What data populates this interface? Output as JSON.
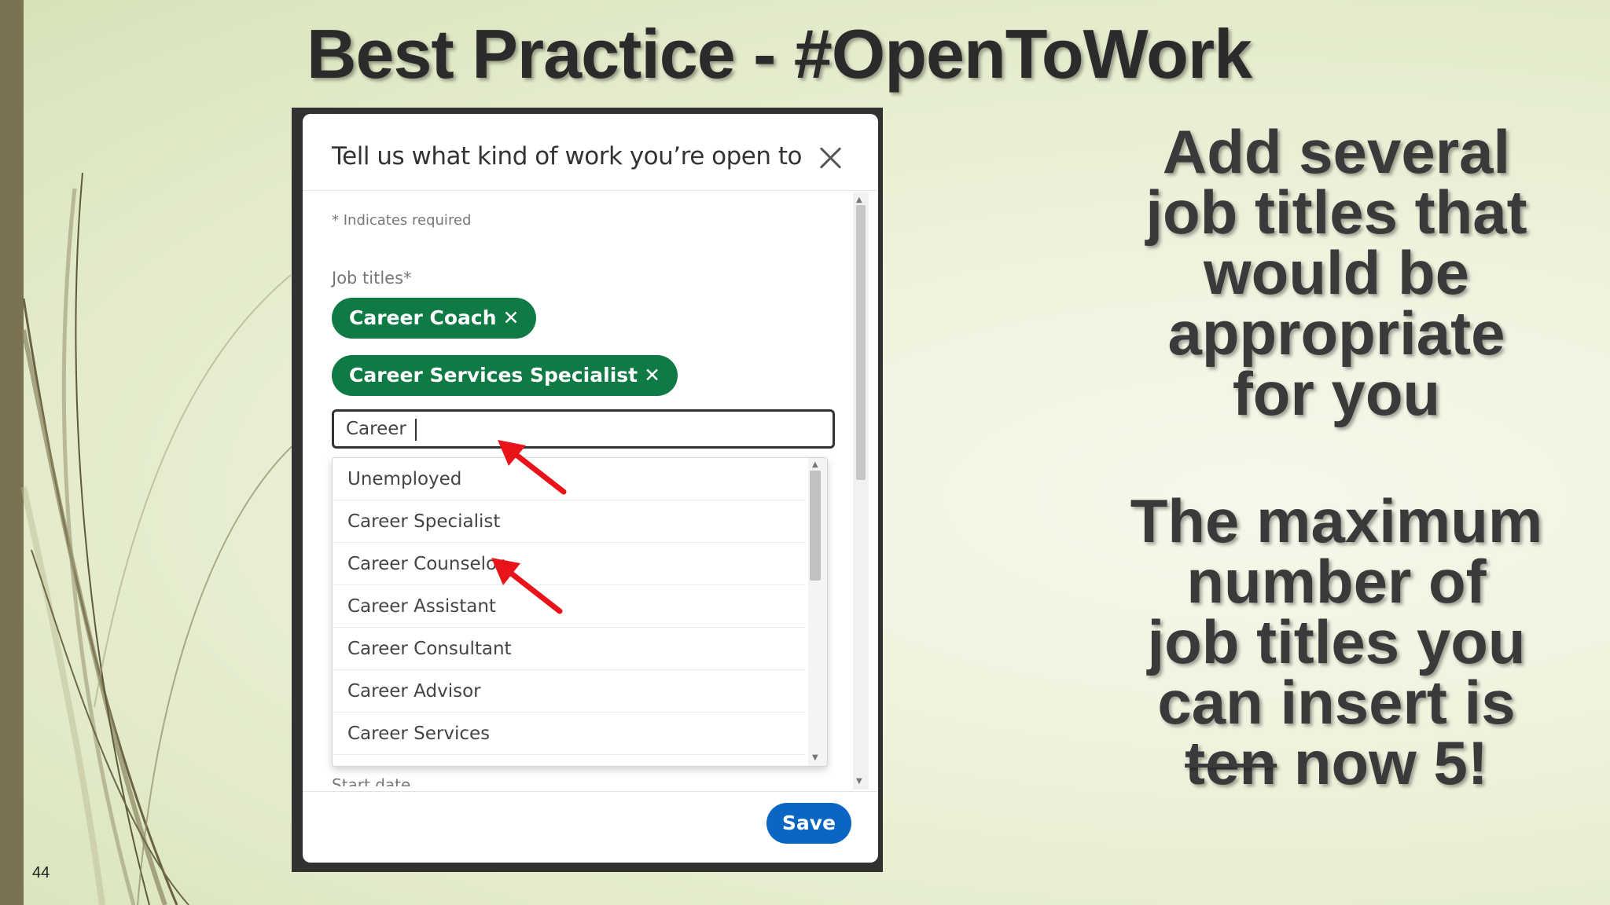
{
  "slide": {
    "title": "Best Practice - #OpenToWork",
    "page_number": "44"
  },
  "modal": {
    "title": "Tell us what kind of work you’re open to",
    "required_note": "* Indicates required",
    "job_titles_label": "Job titles*",
    "chips": [
      {
        "label": "Career Coach",
        "remove": "✕"
      },
      {
        "label": "Career Services Specialist",
        "remove": "✕"
      }
    ],
    "input_value": "Career ",
    "suggestions": [
      "Unemployed",
      "Career Specialist",
      "Career Counselor",
      "Career Assistant",
      "Career Consultant",
      "Career Advisor",
      "Career Services"
    ],
    "start_date_label": "Start date",
    "save_label": "Save"
  },
  "side_text": {
    "block1_lines": [
      "Add several",
      "job titles that",
      "would be",
      "appropriate",
      "for you"
    ],
    "block2_lines": [
      "The maximum",
      "number of",
      "job titles you",
      "can insert is"
    ],
    "block2_struck": "ten",
    "block2_end": " now 5!"
  },
  "colors": {
    "chip_green": "#0f7a44",
    "save_blue": "#0a66c2",
    "arrow_red": "#e8141a",
    "left_bar": "#7a7250"
  },
  "icons": {
    "close": "close-icon",
    "chip_remove": "x-icon",
    "annotation": "red-arrow-icon"
  }
}
